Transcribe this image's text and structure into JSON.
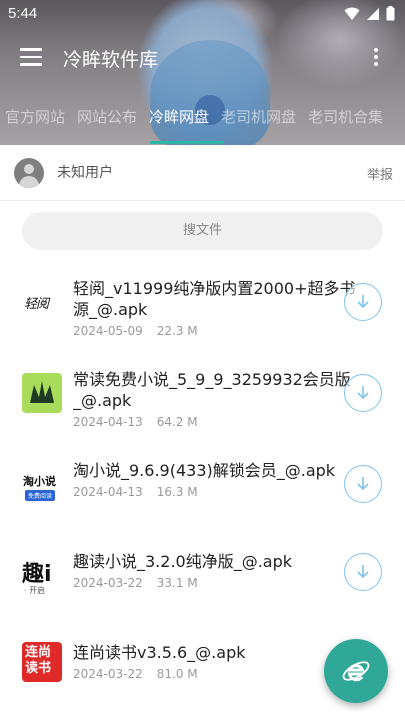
{
  "status": {
    "time": "5:44"
  },
  "toolbar": {
    "title": "冷眸软件库"
  },
  "tabs": [
    "官方网站",
    "网站公布",
    "冷眸网盘",
    "老司机网盘",
    "老司机合集"
  ],
  "user": {
    "name": "未知用户",
    "report_label": "举报"
  },
  "search": {
    "placeholder": "搜文件"
  },
  "files": [
    {
      "name": "轻阅_v11999纯净版内置2000+超多书源_@.apk",
      "date": "2024-05-09",
      "size": "22.3 M",
      "icon": "qingyue-app-icon"
    },
    {
      "name": "常读免费小说_5_9_9_3259932会员版_@.apk",
      "date": "2024-04-13",
      "size": "64.2 M",
      "icon": "changdu-app-icon"
    },
    {
      "name": "淘小说_9.6.9(433)解锁会员_@.apk",
      "date": "2024-04-13",
      "size": "16.3 M",
      "icon": "taoxiaoshuo-app-icon"
    },
    {
      "name": "趣读小说_3.2.0纯净版_@.apk",
      "date": "2024-03-22",
      "size": "33.1 M",
      "icon": "qudu-app-icon"
    },
    {
      "name": "连尚读书v3.5.6_@.apk",
      "date": "2024-03-22",
      "size": "81.0 M",
      "icon": "lianshang-app-icon"
    }
  ],
  "icon_text": {
    "qingyue": "轻阅",
    "taoxiaoshuo": "淘小说",
    "taoxiaoshuo_sub": "免费阅读",
    "qudu": "趣i",
    "qudu_sub": "· 开启",
    "lianshang": "连尚读书"
  },
  "colors": {
    "accent": "#2fa897",
    "tab_indicator": "#2fb4a6",
    "download_ring": "#7fc4ee"
  }
}
